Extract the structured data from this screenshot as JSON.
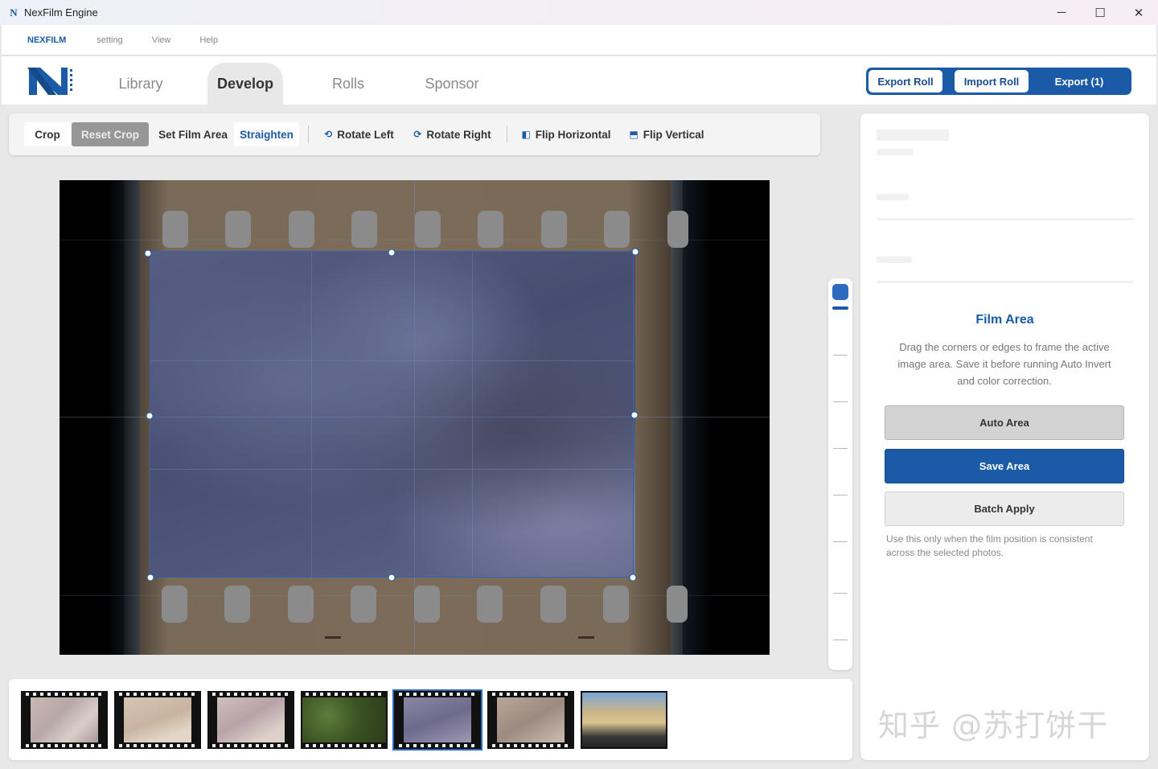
{
  "window": {
    "title": "NexFilm Engine",
    "app_icon_letter": "N",
    "controls": {
      "minimize": "─",
      "maximize": "☐",
      "close": "✕"
    }
  },
  "menubar": {
    "brand": "NEXFILM",
    "items": [
      "setting",
      "View",
      "Help"
    ]
  },
  "header": {
    "logo_letter": "N",
    "tabs": [
      {
        "label": "Library",
        "active": false
      },
      {
        "label": "Develop",
        "active": true
      },
      {
        "label": "Rolls",
        "active": false
      },
      {
        "label": "Sponsor",
        "active": false
      }
    ],
    "actions": {
      "export_roll": "Export Roll",
      "import_roll": "Import Roll",
      "export": "Export (1)"
    }
  },
  "toolbar": {
    "crop": "Crop",
    "reset_crop": "Reset Crop",
    "set_film_area": "Set Film Area",
    "straighten": "Straighten",
    "rotate_left": "Rotate Left",
    "rotate_right": "Rotate Right",
    "flip_horizontal": "Flip Horizontal",
    "flip_vertical": "Flip Vertical",
    "icons": {
      "rotate_left": "rotate-left-icon",
      "rotate_right": "rotate-right-icon",
      "flip_horizontal": "flip-horizontal-icon",
      "flip_vertical": "flip-vertical-icon"
    }
  },
  "panel": {
    "title": "Film Area",
    "description": "Drag the corners or edges to frame the active image area. Save it before running Auto Invert and color correction.",
    "auto_area": "Auto Area",
    "save_area": "Save Area",
    "batch_apply": "Batch Apply",
    "note": "Use this only when the film position is consistent across the selected photos."
  },
  "watermark": "知乎 @苏打饼干",
  "filmstrip": {
    "selected_index": 4,
    "count": 7
  },
  "colors": {
    "accent": "#1a5aa6",
    "crop_border": "#2e64b6",
    "film_base": "#7c6b58"
  }
}
